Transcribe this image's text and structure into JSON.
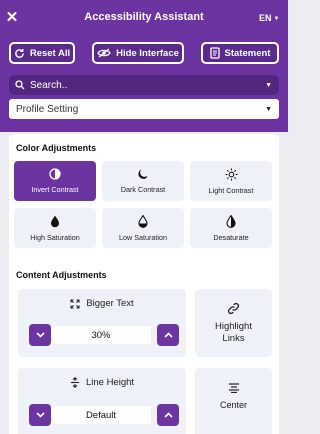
{
  "header": {
    "title": "Accessibility Assistant",
    "language": "EN",
    "buttons": [
      {
        "label": "Reset All",
        "icon": "refresh-icon"
      },
      {
        "label": "Hide Interface",
        "icon": "eye-off-icon"
      },
      {
        "label": "Statement",
        "icon": "document-icon"
      }
    ],
    "search_placeholder": "Search..",
    "profile_select": "Profile Setting"
  },
  "color_adjustments": {
    "heading": "Color Adjustments",
    "items": [
      {
        "label": "Invert Contrast",
        "icon": "half-circle-icon",
        "active": true
      },
      {
        "label": "Dark Contrast",
        "icon": "moon-icon",
        "active": false
      },
      {
        "label": "Light Contrast",
        "icon": "sun-icon",
        "active": false
      },
      {
        "label": "High Saturation",
        "icon": "drop-filled-icon",
        "active": false
      },
      {
        "label": "Low Saturation",
        "icon": "drop-half-icon",
        "active": false
      },
      {
        "label": "Desaturate",
        "icon": "half-drop-icon",
        "active": false
      }
    ]
  },
  "content_adjustments": {
    "heading": "Content Adjustments",
    "bigger_text": {
      "label": "Bigger Text",
      "value": "30%"
    },
    "highlight_links": {
      "label_line1": "Highlight",
      "label_line2": "Links"
    },
    "line_height": {
      "label": "Line Height",
      "value": "Default"
    },
    "center": {
      "label": "Center"
    }
  },
  "colors": {
    "accent": "#6b34a0",
    "accent_dark": "#53277f",
    "tile_bg": "#eef2f8"
  }
}
